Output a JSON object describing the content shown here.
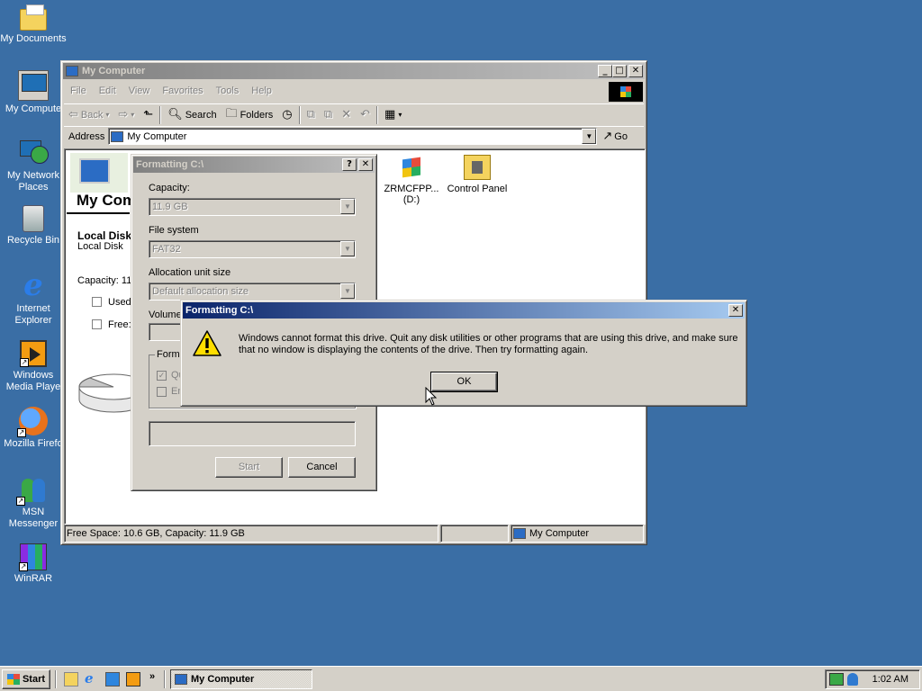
{
  "desktop": {
    "icons": [
      {
        "label": "My Documents",
        "icon": "my-documents-icon"
      },
      {
        "label": "My Compute",
        "icon": "my-computer-icon"
      },
      {
        "label": "My Network\nPlaces",
        "icon": "network-places-icon"
      },
      {
        "label": "Recycle Bin",
        "icon": "recycle-bin-icon"
      },
      {
        "label": "Internet\nExplorer",
        "icon": "internet-explorer-icon"
      },
      {
        "label": "Windows\nMedia Playe",
        "icon": "media-player-icon"
      },
      {
        "label": "Mozilla Firefo",
        "icon": "firefox-icon"
      },
      {
        "label": "MSN\nMessenger",
        "icon": "msn-messenger-icon"
      },
      {
        "label": "WinRAR",
        "icon": "winrar-icon"
      }
    ],
    "background_color": "#3a6ea5"
  },
  "explorer": {
    "title": "My Computer",
    "menu": [
      "File",
      "Edit",
      "View",
      "Favorites",
      "Tools",
      "Help"
    ],
    "toolbar": {
      "back": "Back",
      "search": "Search",
      "folders": "Folders"
    },
    "address": {
      "label": "Address",
      "value": "My Computer",
      "go": "Go"
    },
    "info_panel": {
      "title": "My Com",
      "drive_name": "Local Disk",
      "drive_type": "Local Disk",
      "capacity": "Capacity: 11",
      "used": "Used",
      "free": "Free:"
    },
    "items": [
      {
        "name": "ZRMCFPP...",
        "sub": "(D:)",
        "icon": "windows-cd-icon"
      },
      {
        "name": "Control Panel",
        "sub": "",
        "icon": "control-panel-icon"
      }
    ],
    "status": {
      "left": "Free Space: 10.6 GB, Capacity: 11.9 GB",
      "zone": "My Computer"
    }
  },
  "format_dialog": {
    "title": "Formatting C:\\",
    "capacity_label": "Capacity:",
    "capacity_value": "11.9 GB",
    "filesystem_label": "File system",
    "filesystem_value": "FAT32",
    "alloc_label": "Allocation unit size",
    "alloc_value": "Default allocation size",
    "volume_label": "Volume",
    "options_label": "Forma",
    "quick_format": "Qu",
    "enable_compression": "En",
    "start": "Start",
    "cancel": "Cancel"
  },
  "error_box": {
    "title": "Formatting C:\\",
    "message": "Windows cannot format this drive. Quit any disk utilities or other programs that are using this drive, and make sure that no window is displaying the contents of the drive. Then try formatting again.",
    "ok": "OK",
    "icon": "warning-icon"
  },
  "taskbar": {
    "start": "Start",
    "active_task": "My Computer",
    "clock": "1:02 AM",
    "quicklaunch_more": "»"
  }
}
